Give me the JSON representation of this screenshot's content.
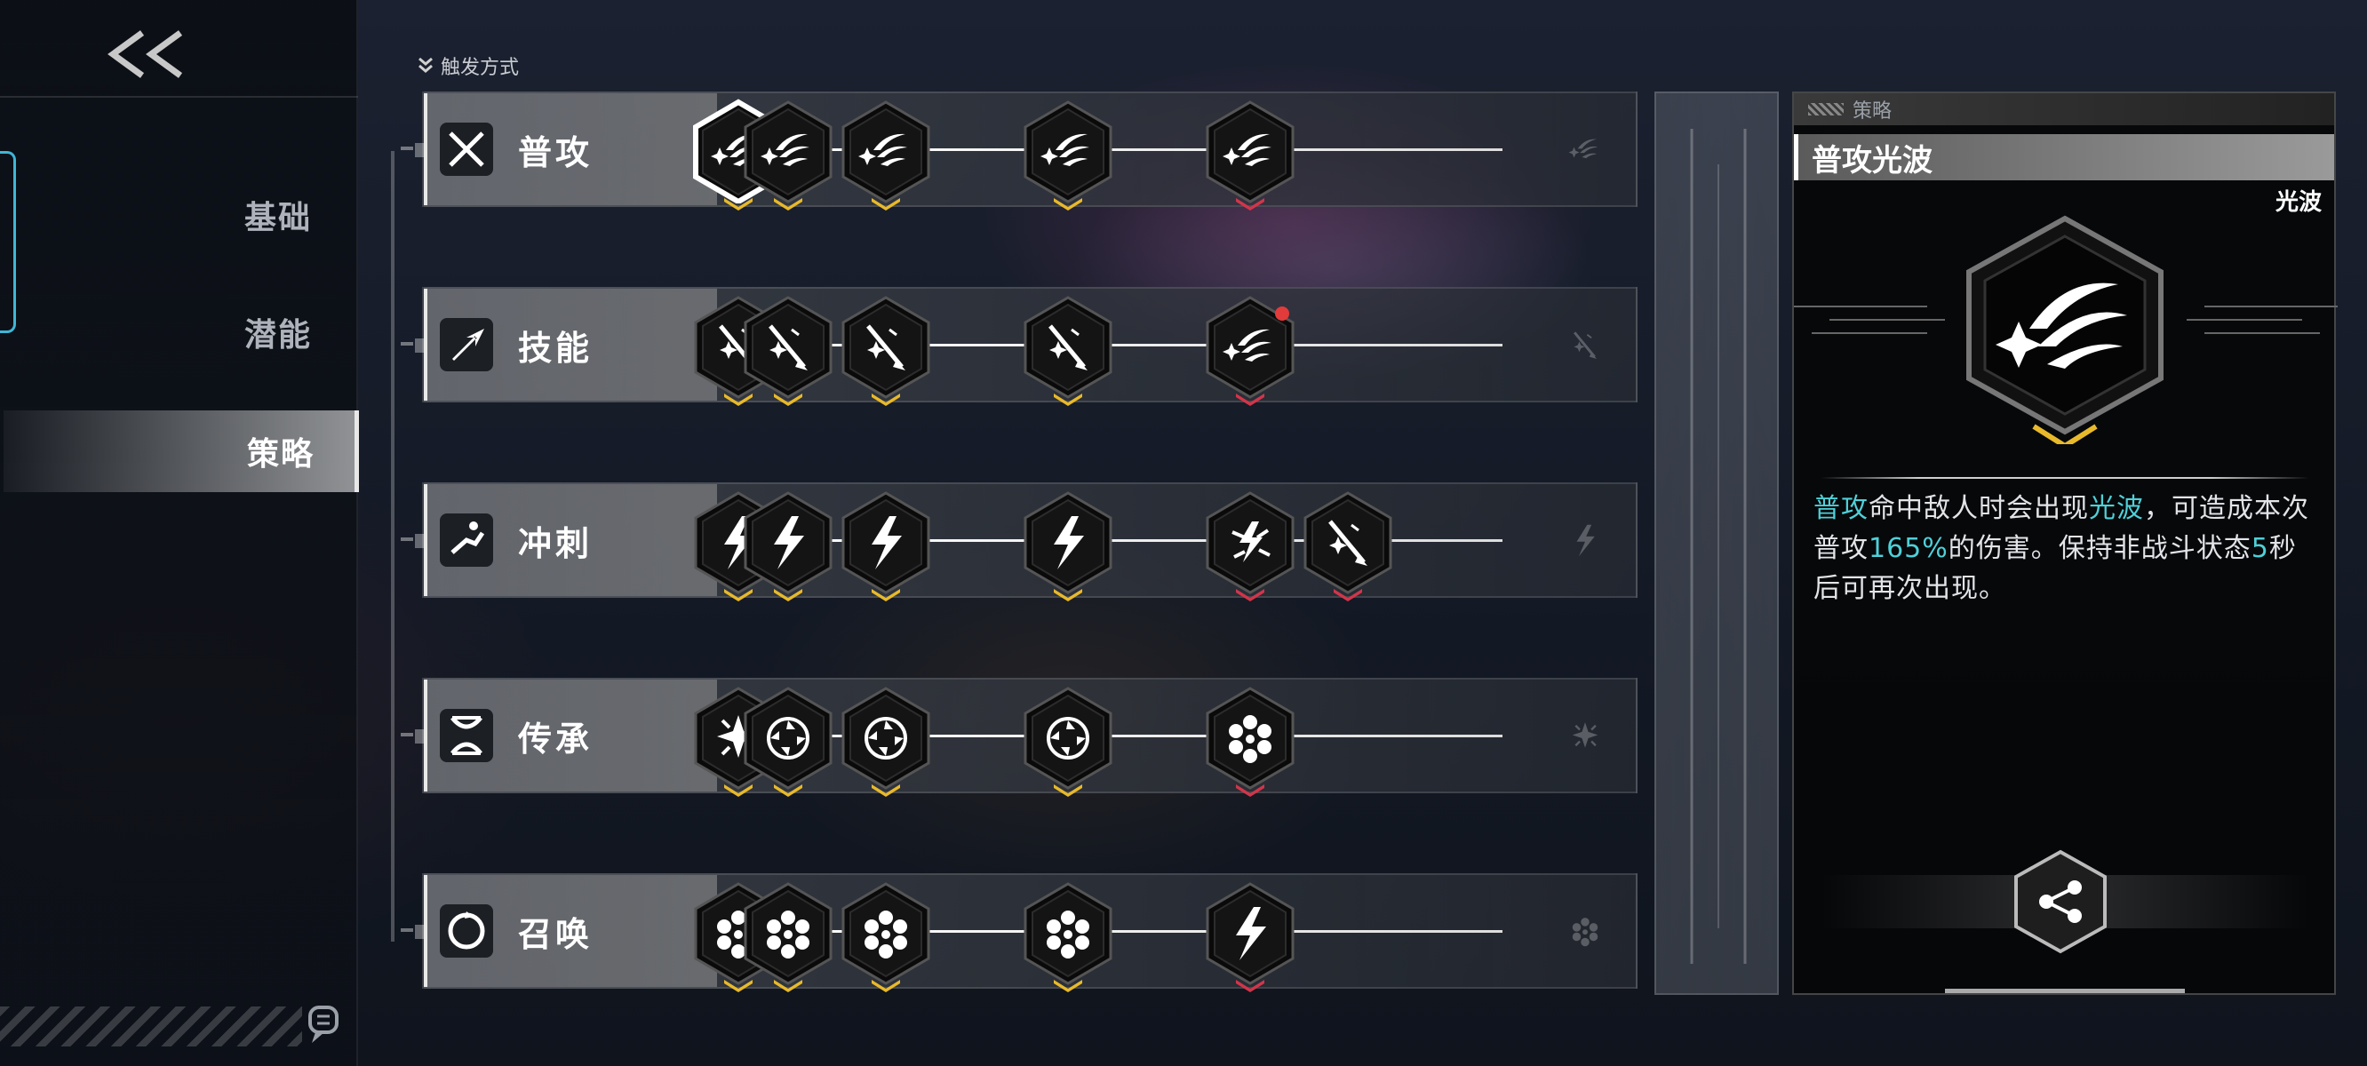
{
  "nav": {
    "back_icon": "double-chevron-left-icon",
    "items": [
      {
        "label": "基础",
        "active": false
      },
      {
        "label": "潜能",
        "active": false
      },
      {
        "label": "策略",
        "active": true
      }
    ],
    "chat_icon": "chat-bubble-icon"
  },
  "trigger": {
    "label": "触发方式",
    "icon": "double-chevron-down-icon"
  },
  "rows": [
    {
      "label": "普攻",
      "icon": "crossed-swords-icon",
      "node_icon": "light-wave-icon",
      "nodes": [
        {
          "icon": "light-wave-icon",
          "chevron": "gold",
          "selected": true
        },
        {
          "icon": "light-wave-icon",
          "chevron": "gold"
        },
        {
          "icon": "light-wave-icon",
          "chevron": "gold"
        },
        {
          "icon": "light-wave-icon",
          "chevron": "gold"
        },
        {
          "icon": "light-wave-icon",
          "chevron": "red"
        }
      ]
    },
    {
      "label": "技能",
      "icon": "skill-arrow-icon",
      "nodes": [
        {
          "icon": "sword-burst-icon",
          "chevron": "gold"
        },
        {
          "icon": "sword-burst-icon",
          "chevron": "gold"
        },
        {
          "icon": "sword-burst-icon",
          "chevron": "gold"
        },
        {
          "icon": "sword-burst-icon",
          "chevron": "gold"
        },
        {
          "icon": "light-wave-icon",
          "chevron": "red",
          "alert": true
        }
      ]
    },
    {
      "label": "冲刺",
      "icon": "dash-runner-icon",
      "nodes": [
        {
          "icon": "lightning-icon",
          "chevron": "gold"
        },
        {
          "icon": "lightning-icon",
          "chevron": "gold"
        },
        {
          "icon": "lightning-icon",
          "chevron": "gold"
        },
        {
          "icon": "lightning-icon",
          "chevron": "gold"
        },
        {
          "icon": "lightning-burst-icon",
          "chevron": "red"
        },
        {
          "icon": "sword-burst-icon",
          "chevron": "red"
        }
      ]
    },
    {
      "label": "传承",
      "icon": "dna-helix-icon",
      "nodes": [
        {
          "icon": "star-burst-icon",
          "chevron": "gold"
        },
        {
          "icon": "vortex-icon",
          "chevron": "gold"
        },
        {
          "icon": "vortex-icon",
          "chevron": "gold"
        },
        {
          "icon": "vortex-icon",
          "chevron": "gold"
        },
        {
          "icon": "flower-ring-icon",
          "chevron": "red"
        }
      ]
    },
    {
      "label": "召唤",
      "icon": "summon-ring-icon",
      "nodes": [
        {
          "icon": "flower-ring-icon",
          "chevron": "gold"
        },
        {
          "icon": "flower-ring-icon",
          "chevron": "gold"
        },
        {
          "icon": "flower-ring-icon",
          "chevron": "gold"
        },
        {
          "icon": "flower-ring-icon",
          "chevron": "gold"
        },
        {
          "icon": "lightning-icon",
          "chevron": "red"
        }
      ]
    }
  ],
  "panel": {
    "tag": "策略",
    "title": "普攻光波",
    "subtitle": "光波",
    "icon": "light-wave-icon",
    "desc_parts": [
      {
        "t": "普攻",
        "hl": true
      },
      {
        "t": "命中敌人时会出现",
        "hl": false
      },
      {
        "t": "光波",
        "hl": true
      },
      {
        "t": "，可造成本次普攻",
        "hl": false
      },
      {
        "t": "165%",
        "hl": true
      },
      {
        "t": "的伤害。保持非战斗状态",
        "hl": false
      },
      {
        "t": "5",
        "hl": true
      },
      {
        "t": "秒后可再次出现。",
        "hl": false
      }
    ],
    "share_icon": "share-icon"
  },
  "colors": {
    "accent": "#4fd0d8",
    "gold": "#e8b92a",
    "red": "#d2354a",
    "frame": "#3fb6d6"
  }
}
